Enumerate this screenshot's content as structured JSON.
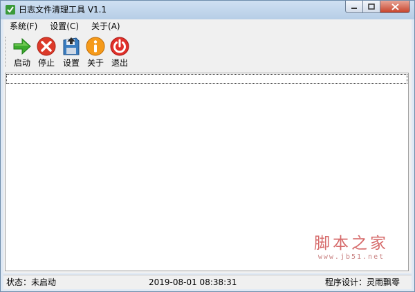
{
  "window": {
    "title": "日志文件清理工具 V1.1"
  },
  "menu": {
    "items": [
      {
        "label": "系统(F)"
      },
      {
        "label": "设置(C)"
      },
      {
        "label": "关于(A)"
      }
    ]
  },
  "toolbar": {
    "items": [
      {
        "label": "启动",
        "icon": "arrow-right-icon"
      },
      {
        "label": "停止",
        "icon": "stop-icon"
      },
      {
        "label": "设置",
        "icon": "floppy-disk-icon"
      },
      {
        "label": "关于",
        "icon": "info-icon"
      },
      {
        "label": "退出",
        "icon": "power-icon"
      }
    ]
  },
  "watermark": {
    "main": "脚本之家",
    "sub": "www.jb51.net"
  },
  "status": {
    "state": "状态：未启动",
    "datetime": "2019-08-01   08:38:31",
    "author": "程序设计：灵雨飘零"
  }
}
